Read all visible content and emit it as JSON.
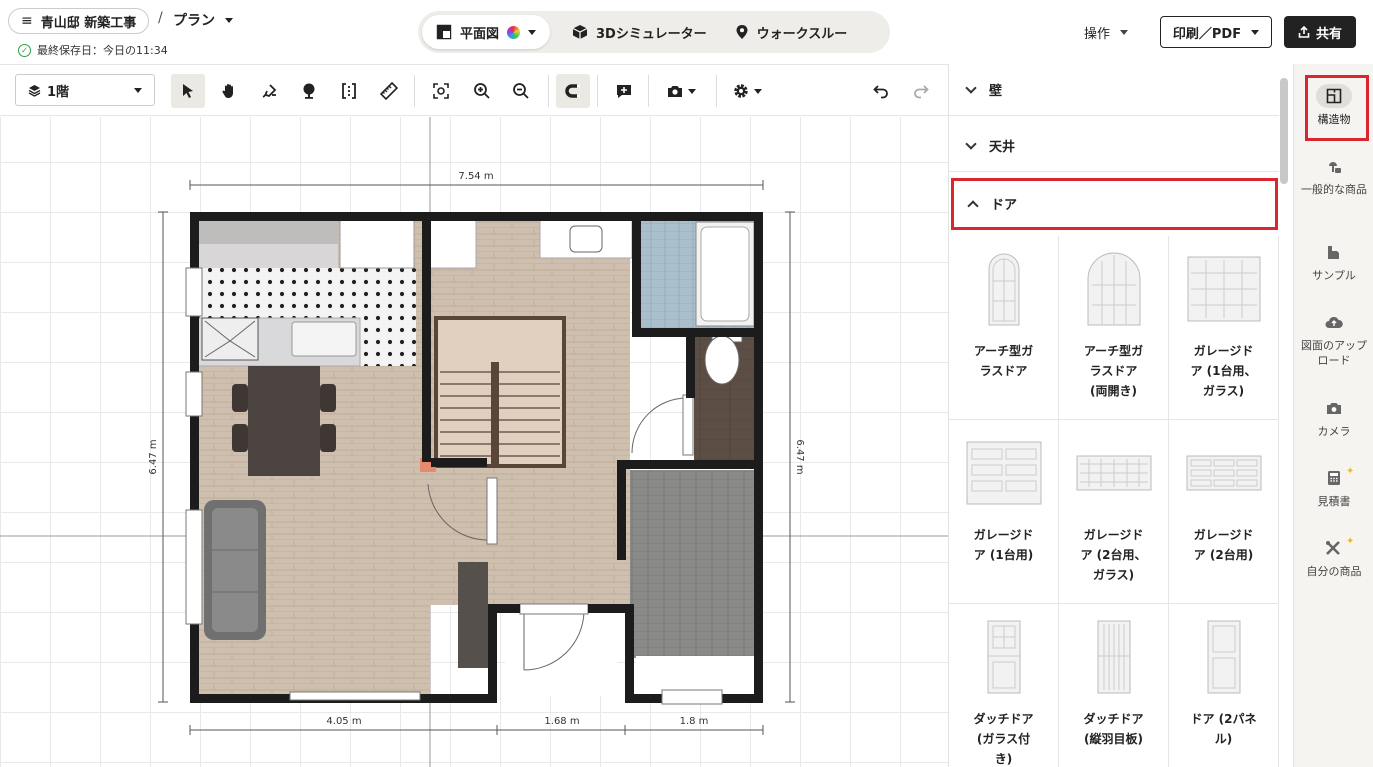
{
  "header": {
    "project_name": "青山邸 新築工事",
    "breadcrumb_sep": "/",
    "plan_label": "プラン",
    "save_status": "最終保存日：今日の11:34",
    "view_tabs": [
      {
        "label": "平面図",
        "active": true
      },
      {
        "label": "3Dシミュレーター",
        "active": false
      },
      {
        "label": "ウォークスルー",
        "active": false
      }
    ],
    "operations_label": "操作",
    "print_label": "印刷／PDF",
    "share_label": "共有"
  },
  "toolbar": {
    "floor_label": "1階",
    "tools": [
      "select-pointer-icon",
      "hand-pan-icon",
      "draw-wall-icon",
      "tree-icon",
      "bracket-select-icon",
      "ruler-icon",
      "zoom-fit-icon",
      "zoom-in-icon",
      "zoom-out-icon",
      "magnet-icon",
      "comment-icon",
      "camera-icon",
      "settings-icon",
      "undo-icon",
      "redo-icon"
    ]
  },
  "floorplan": {
    "dimensions": {
      "top": "7.54 m",
      "left": "6.47 m",
      "right": "6.47 m",
      "bottom_1": "4.05 m",
      "bottom_2": "1.68 m",
      "bottom_3": "1.8 m"
    }
  },
  "panel": {
    "sections": [
      {
        "label": "壁",
        "expanded": false
      },
      {
        "label": "天井",
        "expanded": false
      },
      {
        "label": "ドア",
        "expanded": true
      }
    ],
    "items": [
      {
        "label": "アーチ型ガラスドア",
        "thumb": "arch-single"
      },
      {
        "label": "アーチ型ガラスドア (両開き)",
        "thumb": "arch-double"
      },
      {
        "label": "ガレージドア (1台用、ガラス)",
        "thumb": "garage-glass-1"
      },
      {
        "label": "ガレージドア (1台用)",
        "thumb": "garage-1"
      },
      {
        "label": "ガレージドア (2台用、ガラス)",
        "thumb": "garage-glass-2"
      },
      {
        "label": "ガレージドア (2台用)",
        "thumb": "garage-2"
      },
      {
        "label": "ダッチドア (ガラス付き)",
        "thumb": "dutch-glass"
      },
      {
        "label": "ダッチドア (縦羽目板)",
        "thumb": "dutch-plank"
      },
      {
        "label": "ドア (2パネル)",
        "thumb": "door-2panel"
      }
    ]
  },
  "rail": {
    "items": [
      {
        "label": "構造物",
        "icon": "structure-icon",
        "active": true
      },
      {
        "label": "一般的な商品",
        "icon": "generic-products-icon",
        "active": false
      },
      {
        "label": "サンプル",
        "icon": "sample-icon",
        "active": false
      },
      {
        "label": "図面のアップロード",
        "icon": "upload-icon",
        "active": false
      },
      {
        "label": "カメラ",
        "icon": "camera-icon",
        "active": false
      },
      {
        "label": "見積書",
        "icon": "estimate-icon",
        "active": false
      },
      {
        "label": "自分の商品",
        "icon": "my-products-icon",
        "active": false
      }
    ]
  }
}
